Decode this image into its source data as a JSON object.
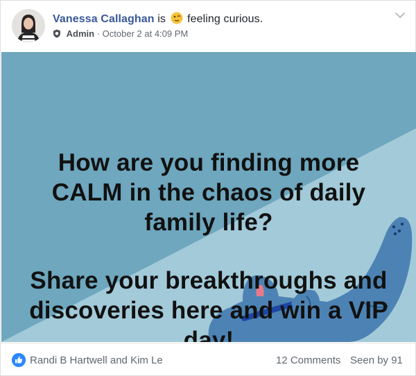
{
  "post": {
    "author": "Vanessa Callaghan",
    "verb": "is",
    "feeling": "feeling curious.",
    "role": "Admin",
    "separator": "·",
    "timestamp": "October 2 at 4:09 PM"
  },
  "image": {
    "question_lines": [
      "How are you finding more",
      "CALM in the chaos of daily",
      "family life?"
    ],
    "callout_lines": [
      "Share your breakthroughs and",
      "discoveries here and win a VIP",
      "day!"
    ]
  },
  "footer": {
    "reactors": "Randi B Hartwell and Kim Le",
    "comments": "12 Comments",
    "seen_by": "Seen by 91"
  },
  "colors": {
    "link_blue": "#385898",
    "image_light_blue": "#a2cad9",
    "image_mid_blue": "#6ea7be",
    "like_blue": "#2d88ff"
  },
  "icons": [
    "avatar",
    "feeling-emoji-icon",
    "admin-shield-icon",
    "chevron-down-icon",
    "like-icon"
  ]
}
